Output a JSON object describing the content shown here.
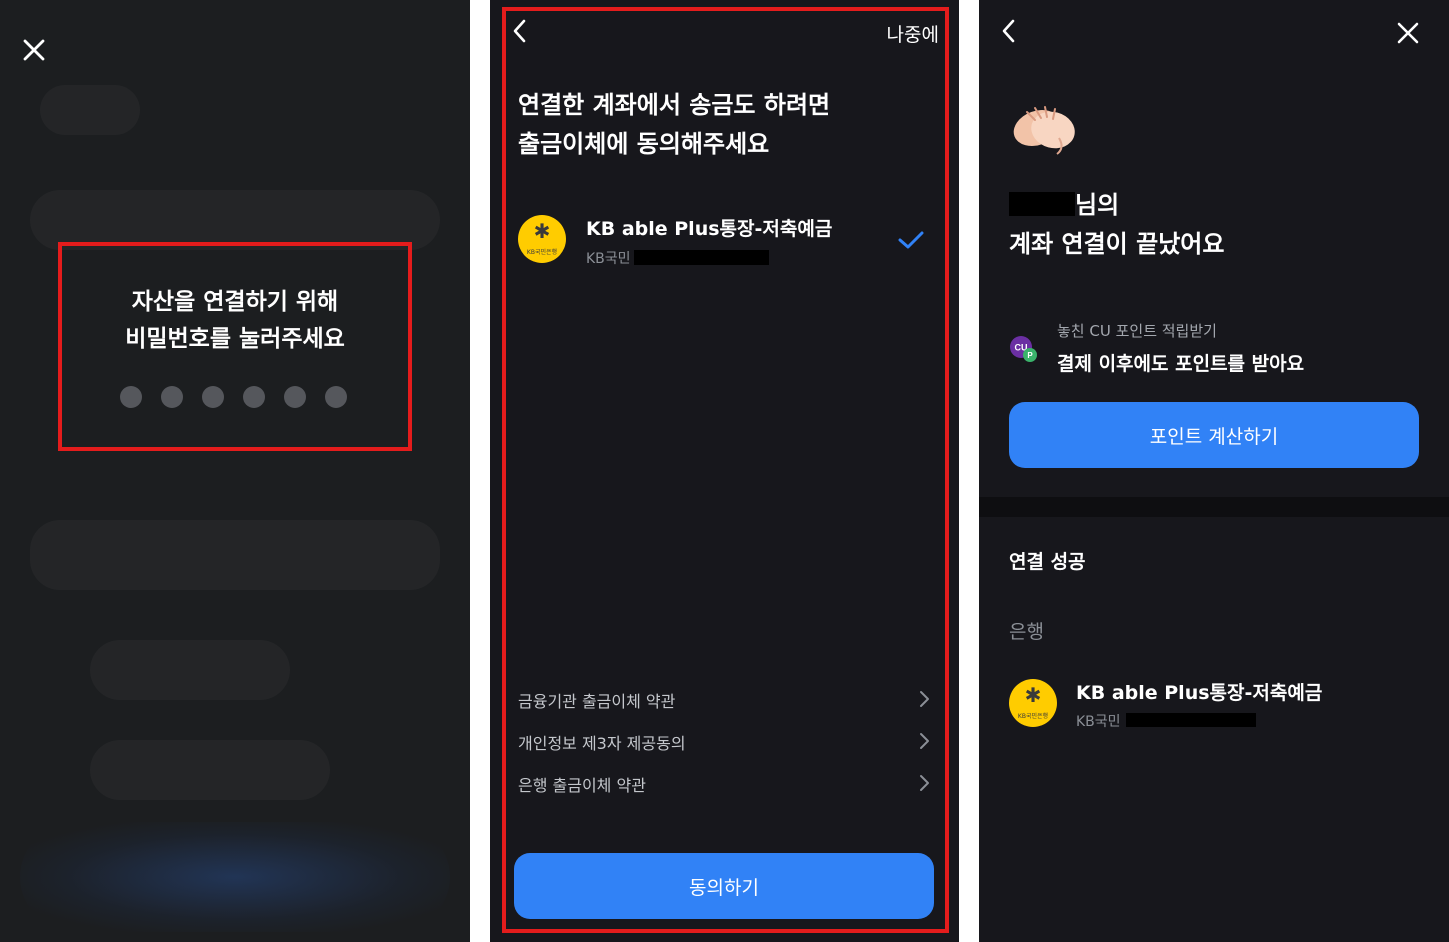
{
  "screen1": {
    "pin_title_line1": "자산을 연결하기 위해",
    "pin_title_line2": "비밀번호를 눌러주세요",
    "pin_length": 6,
    "colors": {
      "highlight": "#e41c1c",
      "dot": "#55575c"
    }
  },
  "screen2": {
    "later_label": "나중에",
    "heading_line1": "연결한 계좌에서 송금도 하려면",
    "heading_line2": "출금이체에 동의해주세요",
    "account": {
      "logo_text": "KB국민은행",
      "name": "KB able Plus통장-저축예금",
      "bank": "KB국민",
      "selected": true
    },
    "terms": [
      {
        "label": "금융기관 출금이체 약관"
      },
      {
        "label": "개인정보 제3자 제공동의"
      },
      {
        "label": "은행 출금이체 약관"
      }
    ],
    "agree_button": "동의하기",
    "colors": {
      "accent": "#3182f6",
      "check": "#3182f6"
    }
  },
  "screen3": {
    "title_suffix": "님의",
    "title_line2": "계좌 연결이 끝났어요",
    "cu_sub": "놓친 CU 포인트 적립받기",
    "cu_main": "결제 이후에도 포인트를 받아요",
    "cu_icon_text": "CU",
    "cu_icon_badge": "P",
    "points_button": "포인트 계산하기",
    "section_title": "연결 성공",
    "section_sub": "은행",
    "account": {
      "logo_text": "KB국민은행",
      "name": "KB able Plus통장-저축예금",
      "bank": "KB국민"
    }
  }
}
